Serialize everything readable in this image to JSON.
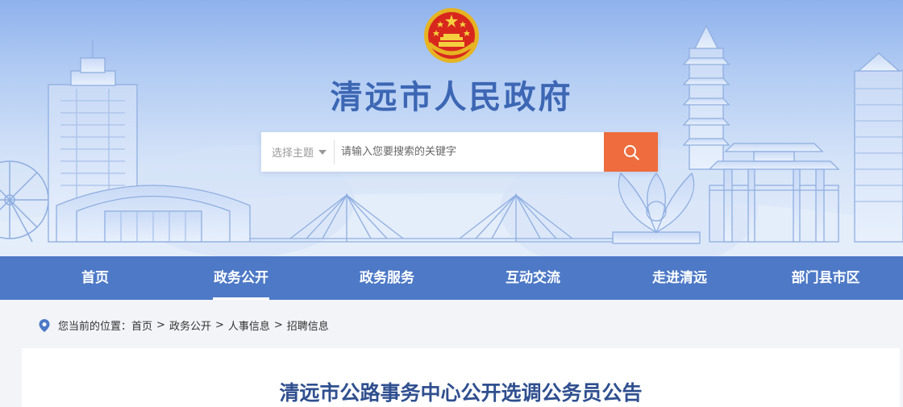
{
  "header": {
    "site_title": "清远市人民政府",
    "emblem_icon": "national-emblem-icon"
  },
  "search": {
    "topic_label": "选择主题",
    "placeholder": "请输入您要搜索的关键字",
    "button_icon": "search-icon",
    "button_color": "#ee6c3d"
  },
  "nav": {
    "items": [
      {
        "label": "首页"
      },
      {
        "label": "政务公开"
      },
      {
        "label": "政务服务"
      },
      {
        "label": "互动交流"
      },
      {
        "label": "走进清远"
      },
      {
        "label": "部门县市区"
      }
    ],
    "active_index": 1,
    "color": "#4d79c7"
  },
  "breadcrumb": {
    "prefix": "您当前的位置：",
    "items": [
      "首页",
      "政务公开",
      "人事信息",
      "招聘信息"
    ],
    "separator": ">"
  },
  "article": {
    "title": "清远市公路事务中心公开选调公务员公告"
  }
}
